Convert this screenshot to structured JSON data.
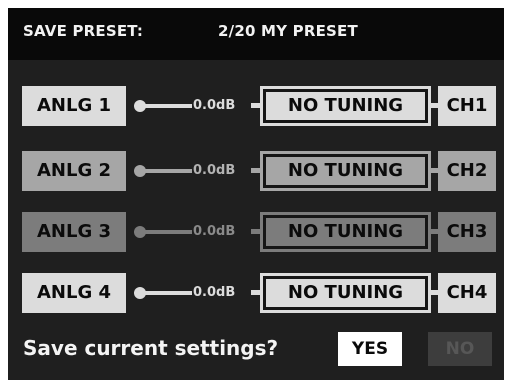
{
  "header": {
    "label": "SAVE PRESET:",
    "preset": "2/20 MY PRESET"
  },
  "channels": [
    {
      "input": "ANLG 1",
      "gain": "0.0dB",
      "tuning": "NO TUNING",
      "output": "CH1",
      "state": "active"
    },
    {
      "input": "ANLG 2",
      "gain": "0.0dB",
      "tuning": "NO TUNING",
      "output": "CH2",
      "state": "normal"
    },
    {
      "input": "ANLG 3",
      "gain": "0.0dB",
      "tuning": "NO TUNING",
      "output": "CH3",
      "state": "dimmed"
    },
    {
      "input": "ANLG 4",
      "gain": "0.0dB",
      "tuning": "NO TUNING",
      "output": "CH4",
      "state": "active"
    }
  ],
  "footer": {
    "question": "Save current settings?",
    "yes_label": "YES",
    "no_label": "NO"
  },
  "colors": {
    "background": "#1f1f1f",
    "header_background": "#090909",
    "active": "#dcdcdc",
    "normal": "#a6a6a6",
    "dimmed": "#7c7c7c",
    "yes_button": "#ffffff",
    "no_button": "#3d3d3d"
  }
}
